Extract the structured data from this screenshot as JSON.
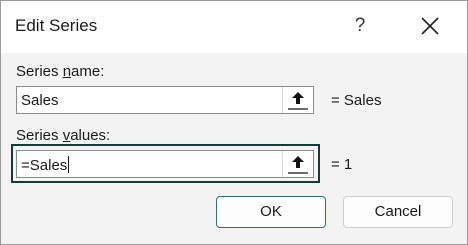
{
  "dialog": {
    "title": "Edit Series",
    "help_glyph": "?",
    "series_name": {
      "label_pre": "Series ",
      "label_accel": "n",
      "label_post": "ame:",
      "value": "Sales",
      "result": "= Sales"
    },
    "series_values": {
      "label_pre": "Series ",
      "label_accel": "v",
      "label_post": "alues:",
      "value": "=Sales",
      "result": "= 1"
    },
    "buttons": {
      "ok": "OK",
      "cancel": "Cancel"
    },
    "icons": {
      "help": "help-icon",
      "close": "close-icon",
      "collapse": "collapse-dialog-icon"
    },
    "colors": {
      "focus_border": "#103c3c",
      "ok_border": "#2e6f7a"
    }
  }
}
